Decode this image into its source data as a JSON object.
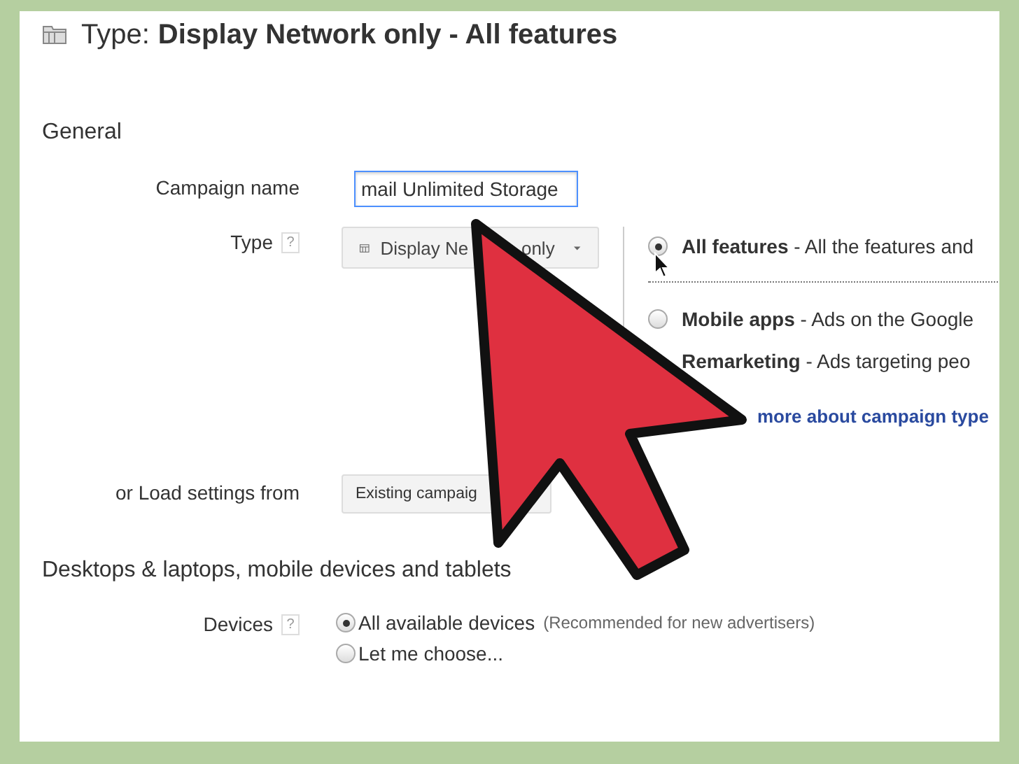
{
  "header": {
    "prefix": "Type:",
    "value": "Display Network only - All features"
  },
  "general": {
    "title": "General",
    "campaign_name": {
      "label": "Campaign name",
      "value": "mail Unlimited Storage"
    },
    "type": {
      "label": "Type",
      "help": "?",
      "dropdown_parts": [
        "Display Ne",
        "only"
      ],
      "options": [
        {
          "name": "All features",
          "description": " - All the features and",
          "selected": true
        },
        {
          "name": "Mobile apps",
          "description": " - Ads on the Google",
          "selected": false
        },
        {
          "name": "Remarketing",
          "description": " - Ads targeting peo"
        }
      ],
      "link": "more about campaign type"
    },
    "load_settings": {
      "label": "or Load settings from",
      "button": "Existing campaig"
    }
  },
  "devices_section": {
    "title": "Desktops & laptops, mobile devices and tablets",
    "devices": {
      "label": "Devices",
      "help": "?",
      "options": [
        {
          "label": "All available devices",
          "note": "(Recommended for new advertisers)",
          "selected": true
        },
        {
          "label": "Let me choose...",
          "selected": false
        }
      ]
    }
  }
}
